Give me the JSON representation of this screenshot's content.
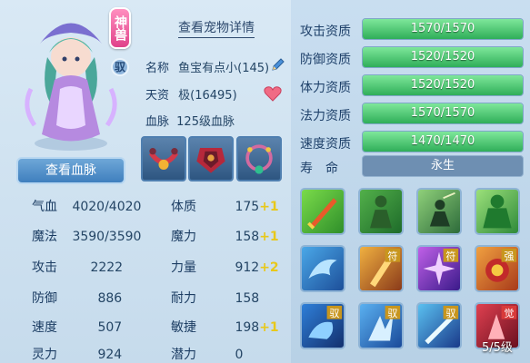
{
  "header": {
    "detail_link": "查看宠物详情"
  },
  "pet": {
    "badge": "神兽",
    "mount_badge": "驭",
    "name_label": "名称",
    "name_value": "鱼宝有点小(145)",
    "talent_label": "天资",
    "talent_value": "极(16495)",
    "bloodline_label": "血脉",
    "bloodline_value": "125级血脉",
    "bloodline_button": "查看血脉"
  },
  "stats": {
    "hp_label": "气血",
    "hp_value": "4020/4020",
    "mp_label": "魔法",
    "mp_value": "3590/3590",
    "atk_label": "攻击",
    "atk_value": "2222",
    "def_label": "防御",
    "def_value": "886",
    "spd_label": "速度",
    "spd_value": "507",
    "spirit_label": "灵力",
    "spirit_value": "924",
    "con_label": "体质",
    "con_value": "175",
    "con_plus": "+1",
    "mag_label": "魔力",
    "mag_value": "158",
    "mag_plus": "+1",
    "str_label": "力量",
    "str_value": "912",
    "str_plus": "+2",
    "end_label": "耐力",
    "end_value": "158",
    "agi_label": "敏捷",
    "agi_value": "198",
    "agi_plus": "+1",
    "pot_label": "潜力",
    "pot_value": "0"
  },
  "qualifications": [
    {
      "label": "攻击资质",
      "text": "1570/1570",
      "fill": 1.0
    },
    {
      "label": "防御资质",
      "text": "1520/1520",
      "fill": 1.0
    },
    {
      "label": "体力资质",
      "text": "1520/1520",
      "fill": 1.0
    },
    {
      "label": "法力资质",
      "text": "1570/1570",
      "fill": 1.0
    },
    {
      "label": "速度资质",
      "text": "1470/1470",
      "fill": 1.0
    }
  ],
  "lifespan": {
    "label": "寿　命",
    "value": "永生"
  },
  "skills": {
    "count": "5/5级",
    "tag_fu": "符",
    "tag_qiang": "强",
    "tag_yu": "驭",
    "tag_jue": "觉"
  },
  "colors": {
    "accent_green": "#3fbf66",
    "plus_yellow": "#e8c81a",
    "badge_pink": "#e0428a"
  }
}
